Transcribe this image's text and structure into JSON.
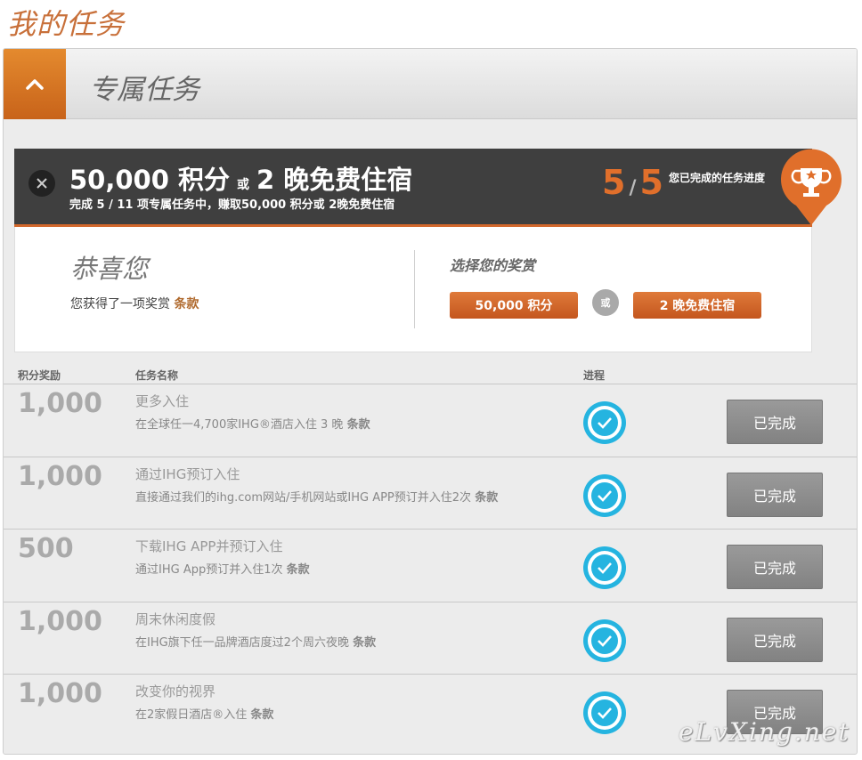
{
  "page": {
    "title": "我的任务"
  },
  "panel": {
    "title": "专属任务",
    "toggle_icon": "chevron-up-icon"
  },
  "banner": {
    "points": "50,000 积分",
    "or": "或",
    "nights": "2 晚免费住宿",
    "subtitle": "完成 5 / 11 项专属任务中，赚取50,000 积分或 2晚免费住宿",
    "progress_done": "5",
    "progress_slash": "/",
    "progress_total": "5",
    "progress_label": "您已完成的任务进度",
    "close_icon": "close-icon",
    "trophy_icon": "trophy-icon",
    "accent_color": "#d2682c"
  },
  "reward": {
    "congrats": "恭喜您",
    "earned_text": "您获得了一项奖赏",
    "terms": "条款",
    "choose_label": "选择您的奖赏",
    "option_points": "50,000 积分",
    "or": "或",
    "option_nights": "2 晚免费住宿"
  },
  "table": {
    "headers": {
      "points": "积分奖励",
      "task": "任务名称",
      "progress": "进程"
    },
    "rows": [
      {
        "points": "1,000",
        "name": "更多入住",
        "desc": "在全球任一4,700家IHG®酒店入住 3 晚",
        "terms": "条款",
        "status": "已完成"
      },
      {
        "points": "1,000",
        "name": "通过IHG预订入住",
        "desc": "直接通过我们的ihg.com网站/手机网站或IHG APP预订并入住2次",
        "terms": "条款",
        "status": "已完成"
      },
      {
        "points": "500",
        "name": "下载IHG APP并预订入住",
        "desc": "通过IHG App预订并入住1次",
        "terms": "条款",
        "status": "已完成"
      },
      {
        "points": "1,000",
        "name": "周末休闲度假",
        "desc": "在IHG旗下任一品牌酒店度过2个周六夜晚",
        "terms": "条款",
        "status": "已完成"
      },
      {
        "points": "1,000",
        "name": "改变你的视界",
        "desc": "在2家假日酒店®入住",
        "terms": "条款",
        "status": "已完成"
      }
    ],
    "check_color": "#25b4e0"
  },
  "watermark": "eLvXing.net"
}
